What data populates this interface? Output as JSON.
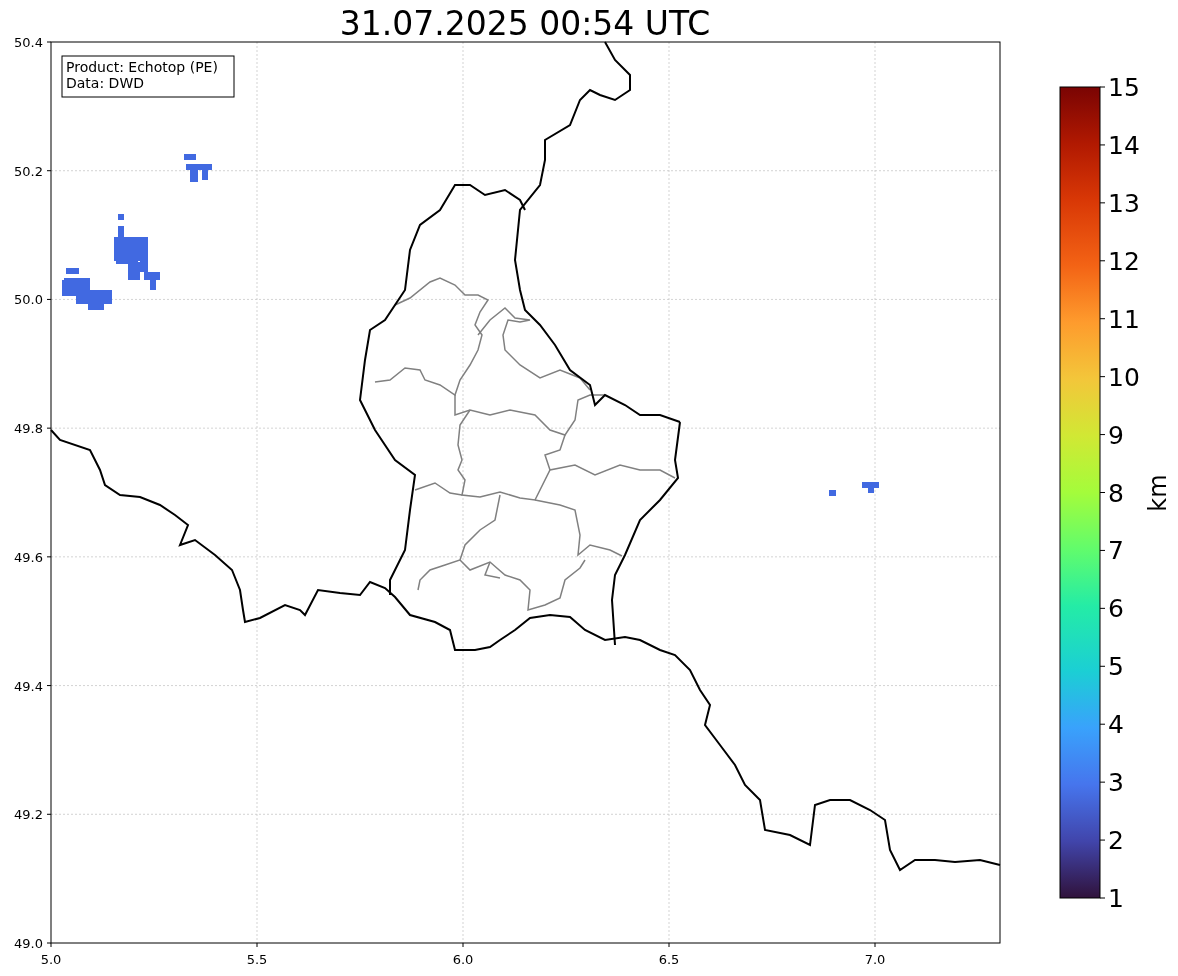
{
  "title": "31.07.2025 00:54 UTC",
  "info_box": [
    "Product: Echotop (PE)",
    "Data: DWD"
  ],
  "x_ticks": [
    "5.0",
    "5.5",
    "6.0",
    "6.5",
    "7.0"
  ],
  "y_ticks": [
    "50.4",
    "50.2",
    "50.0",
    "49.8",
    "49.6",
    "49.4",
    "49.2",
    "49.0"
  ],
  "colorbar": {
    "label": "km",
    "ticks": [
      "15",
      "14",
      "13",
      "12",
      "11",
      "10",
      "9",
      "8",
      "7",
      "6",
      "5",
      "4",
      "3",
      "2",
      "1"
    ]
  }
}
